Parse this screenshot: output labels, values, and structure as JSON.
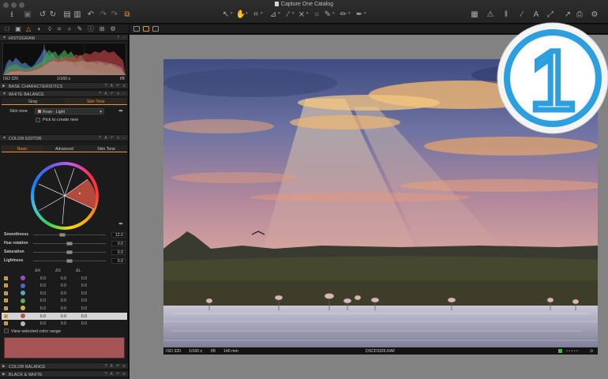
{
  "window": {
    "title": "Capture One Catalog",
    "traffic_lights": [
      "close",
      "minimize",
      "zoom"
    ]
  },
  "toolbar": {
    "left": [
      "import-icon",
      "camera-icon",
      "rotate-left-icon",
      "rotate-right-icon",
      "folder-icon",
      "trash-icon",
      "undo-icon",
      "redo-icon",
      "forward-icon",
      "copy-apply-icon"
    ],
    "center": [
      "cursor-tool-icon",
      "pan-tool-icon",
      "crop-tool-icon",
      "rotate-tool-icon",
      "keystone-tool-icon",
      "spot-tool-icon",
      "brush-tool-icon",
      "eraser-tool-icon",
      "picker-tool-icon"
    ],
    "right": [
      "grid-view-icon",
      "warning-icon",
      "compare-icon",
      "pen-icon",
      "text-icon",
      "expand-icon",
      "export-icon",
      "print-icon",
      "settings-icon"
    ]
  },
  "tool_tabs": [
    "library-tab-icon",
    "camera-tab-icon",
    "color-tab-icon",
    "exposure-tab-icon",
    "details-tab-icon",
    "crop-tab-icon",
    "search-tab-icon",
    "adjust-tab-icon",
    "metadata-tab-icon",
    "output-tab-icon",
    "batch-tab-icon"
  ],
  "histogram": {
    "title": "HISTOGRAM",
    "iso": "ISO 320",
    "shutter": "1/160 s",
    "aperture": "f/8"
  },
  "sections": {
    "base_characteristics": "BASE CHARACTERISTICS",
    "white_balance": "WHITE BALANCE",
    "color_editor": "COLOR EDITOR",
    "color_balance": "COLOR BALANCE",
    "black_white": "BLACK & WHITE"
  },
  "white_balance": {
    "tabs": [
      "Gray",
      "Skin Tone"
    ],
    "active_tab": "Skin Tone",
    "skin_tone_label": "Skin tone",
    "skin_tone_value": "Rose - Light",
    "pick_label": "Pick to create new"
  },
  "color_editor": {
    "tabs": [
      "Basic",
      "Advanced",
      "Skin Tone"
    ],
    "active_tab": "Basic",
    "sliders": [
      {
        "label": "Smoothness",
        "value": "12.0",
        "position": 0.4
      },
      {
        "label": "Hue rotation",
        "value": "0.0",
        "position": 0.5
      },
      {
        "label": "Saturation",
        "value": "0.0",
        "position": 0.5
      },
      {
        "label": "Lightness",
        "value": "0.0",
        "position": 0.5
      }
    ],
    "columns": [
      "ΔH",
      "ΔS",
      "ΔL"
    ],
    "rows": [
      {
        "color": "#a04bbd",
        "h": "0.0",
        "s": "0.0",
        "l": "0.0",
        "selected": false
      },
      {
        "color": "#5f5fc4",
        "h": "0.0",
        "s": "0.0",
        "l": "0.0",
        "selected": false
      },
      {
        "color": "#4fb3c0",
        "h": "0.0",
        "s": "0.0",
        "l": "0.0",
        "selected": false
      },
      {
        "color": "#5fae5a",
        "h": "0.0",
        "s": "0.0",
        "l": "0.0",
        "selected": false
      },
      {
        "color": "#c9b64a",
        "h": "0.0",
        "s": "0.0",
        "l": "0.0",
        "selected": false
      },
      {
        "color": "#b75548",
        "h": "0.0",
        "s": "0.0",
        "l": "0.0",
        "selected": true
      },
      {
        "color": "#b9b9b9",
        "h": "0.0",
        "s": "0.0",
        "l": "0.0",
        "selected": false
      }
    ],
    "view_selected_label": "View selected color range",
    "swatch_color": "#a65455",
    "selected_slice_color": "#b34a3c"
  },
  "viewer": {
    "iso": "ISO 320",
    "shutter": "1/160 s",
    "aperture": "f/8",
    "focal": "140 mm",
    "filename": "DSCF9326.RAF"
  },
  "badge": {
    "digit": "1",
    "ring_color": "#2b9fe0",
    "background_color": "#f4f4f4"
  },
  "colors": {
    "accent": "#e9923a",
    "panel": "#1b1b1b",
    "header": "#2a2a2a",
    "viewer_bg": "#828282"
  }
}
